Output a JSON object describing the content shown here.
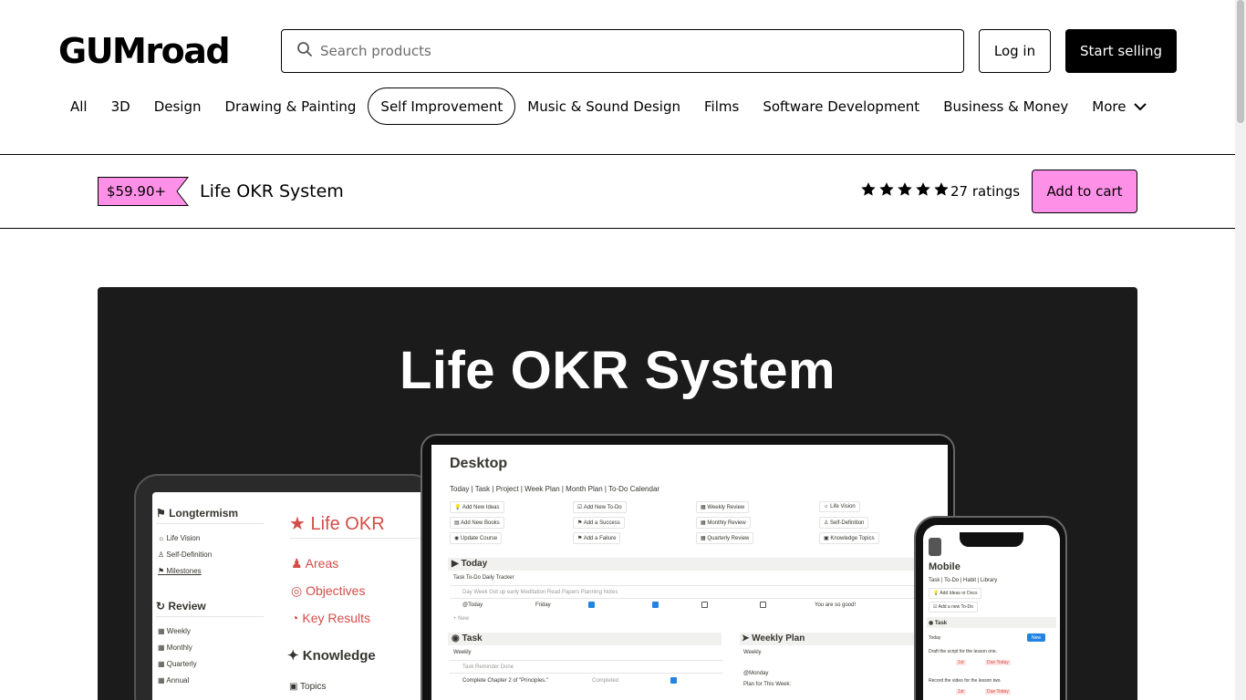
{
  "header": {
    "logo": "GUMroad",
    "search_placeholder": "Search products",
    "login_label": "Log in",
    "start_selling_label": "Start selling"
  },
  "categories": [
    "All",
    "3D",
    "Design",
    "Drawing & Painting",
    "Self Improvement",
    "Music & Sound Design",
    "Films",
    "Software Development",
    "Business & Money",
    "More"
  ],
  "active_category": "Self Improvement",
  "product": {
    "price": "$59.90+",
    "title": "Life OKR System",
    "stars": 5,
    "ratings_label": "27 ratings",
    "add_to_cart_label": "Add to cart"
  },
  "colors": {
    "accent_pink": "#ff90e8",
    "hero_bg": "#1c1b1b"
  },
  "hero": {
    "title": "Life OKR System",
    "tablet": {
      "longtermism": "Longtermism",
      "life_vision": "Life Vision",
      "self_definition": "Self-Definition",
      "milestones": "Milestones",
      "review": "Review",
      "weekly": "Weekly",
      "monthly": "Monthly",
      "quarterly": "Quarterly",
      "annual": "Annual",
      "life_okr": "Life OKR",
      "areas": "Areas",
      "objectives": "Objectives",
      "key_results": "Key Results",
      "knowledge": "Knowledge",
      "topics": "Topics"
    },
    "desktop": {
      "title": "Desktop",
      "nav": "Today  |  Task  |  Project  |  Week Plan  |  Month Plan  |  To-Do Calendar",
      "buttons": [
        "Add New Ideas",
        "Add New Books",
        "Update Course",
        "Add New To-Do",
        "Add a Success",
        "Add a Failure",
        "Weekly Review",
        "Monthly Review",
        "Quarterly Review",
        "Life Vision",
        "Self-Definition",
        "Knowledge Topics"
      ],
      "today": "Today",
      "today_tabs": "Task   To-Do   Daily Tracker",
      "tracker_header": "Day    Week    Got up early    Meditation    Read Papers    Planning    Notes",
      "tracker_row_day": "@Today",
      "tracker_row_week": "Friday",
      "tracker_row_note": "You are so good!",
      "new": "+ New",
      "task": "Task",
      "weekly_tab": "Weekly",
      "task_header": "Task                         Reminder       Done",
      "task_row": "Complete Chapter 2 of \"Principles.\"",
      "task_row_status": "Completed",
      "weekly_plan": "Weekly Plan",
      "weekly_plan_tab": "Weekly",
      "monday": "@Monday",
      "plan_for_week": "Plan for This Week:"
    },
    "mobile": {
      "title": "Mobile",
      "nav": "Task  |  To-Do  |  Habit  |  Library",
      "btn1": "Add Ideas or Docs",
      "btn2": "Add a new To-Do",
      "task": "Task",
      "today": "Today",
      "new": "New",
      "item1": "Draft the script for the lesson one.",
      "item2": "Record the video for the lesson two.",
      "tag1": "1st",
      "tag2": "Due Today"
    }
  }
}
